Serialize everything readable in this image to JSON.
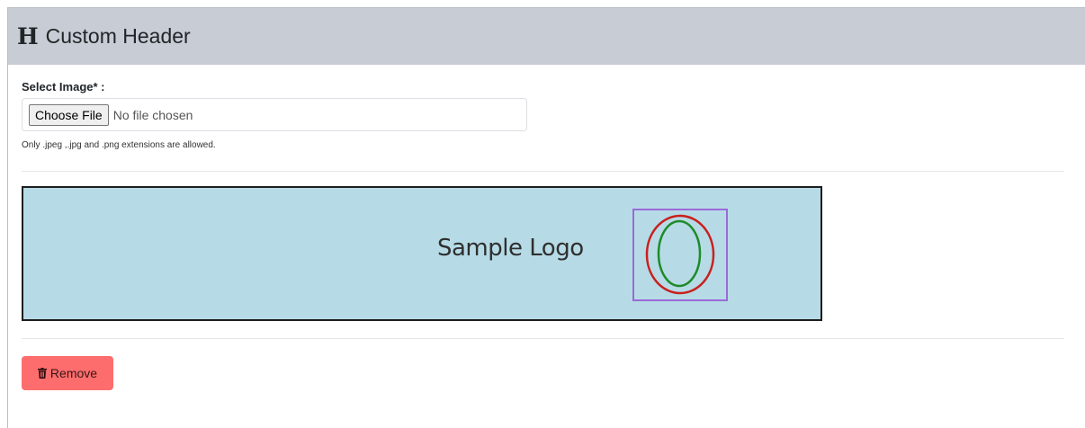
{
  "header": {
    "icon": "heading-icon",
    "icon_glyph": "H",
    "title": "Custom Header"
  },
  "form": {
    "label": "Select Image* :",
    "choose_button": "Choose File",
    "file_status": "No file chosen",
    "help_text": "Only .jpeg ,.jpg and .png extensions are allowed."
  },
  "preview": {
    "logo_text": "Sample Logo",
    "background_color": "#b6dbe6",
    "mark_box_color": "#9b6ad8",
    "mark_outer_color": "#c8201e",
    "mark_inner_color": "#1f8a2a"
  },
  "actions": {
    "remove_label": "Remove",
    "remove_icon": "trash-icon",
    "remove_color": "#fd6d6d"
  }
}
